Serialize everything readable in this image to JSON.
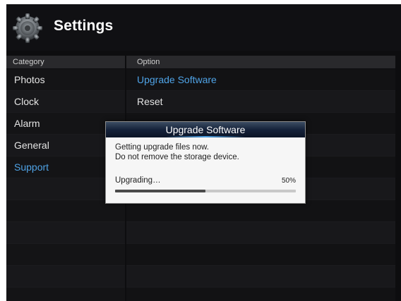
{
  "header": {
    "title": "Settings",
    "icon": "gear-icon"
  },
  "columns": {
    "category_label": "Category",
    "option_label": "Option"
  },
  "categories": [
    {
      "label": "Photos",
      "active": false
    },
    {
      "label": "Clock",
      "active": false
    },
    {
      "label": "Alarm",
      "active": false
    },
    {
      "label": "General",
      "active": false
    },
    {
      "label": "Support",
      "active": true
    }
  ],
  "options": [
    {
      "label": "Upgrade Software",
      "active": true
    },
    {
      "label": "Reset",
      "active": false
    }
  ],
  "dialog": {
    "title": "Upgrade Software",
    "message_line1": "Getting upgrade files now.",
    "message_line2": "Do not remove the storage device.",
    "status": "Upgrading…",
    "percent_label": "50%",
    "progress": 0.5
  },
  "colors": {
    "accent": "#4fa3e6",
    "background": "#0d0d0f",
    "dialog_bg": "#f6f6f6"
  }
}
